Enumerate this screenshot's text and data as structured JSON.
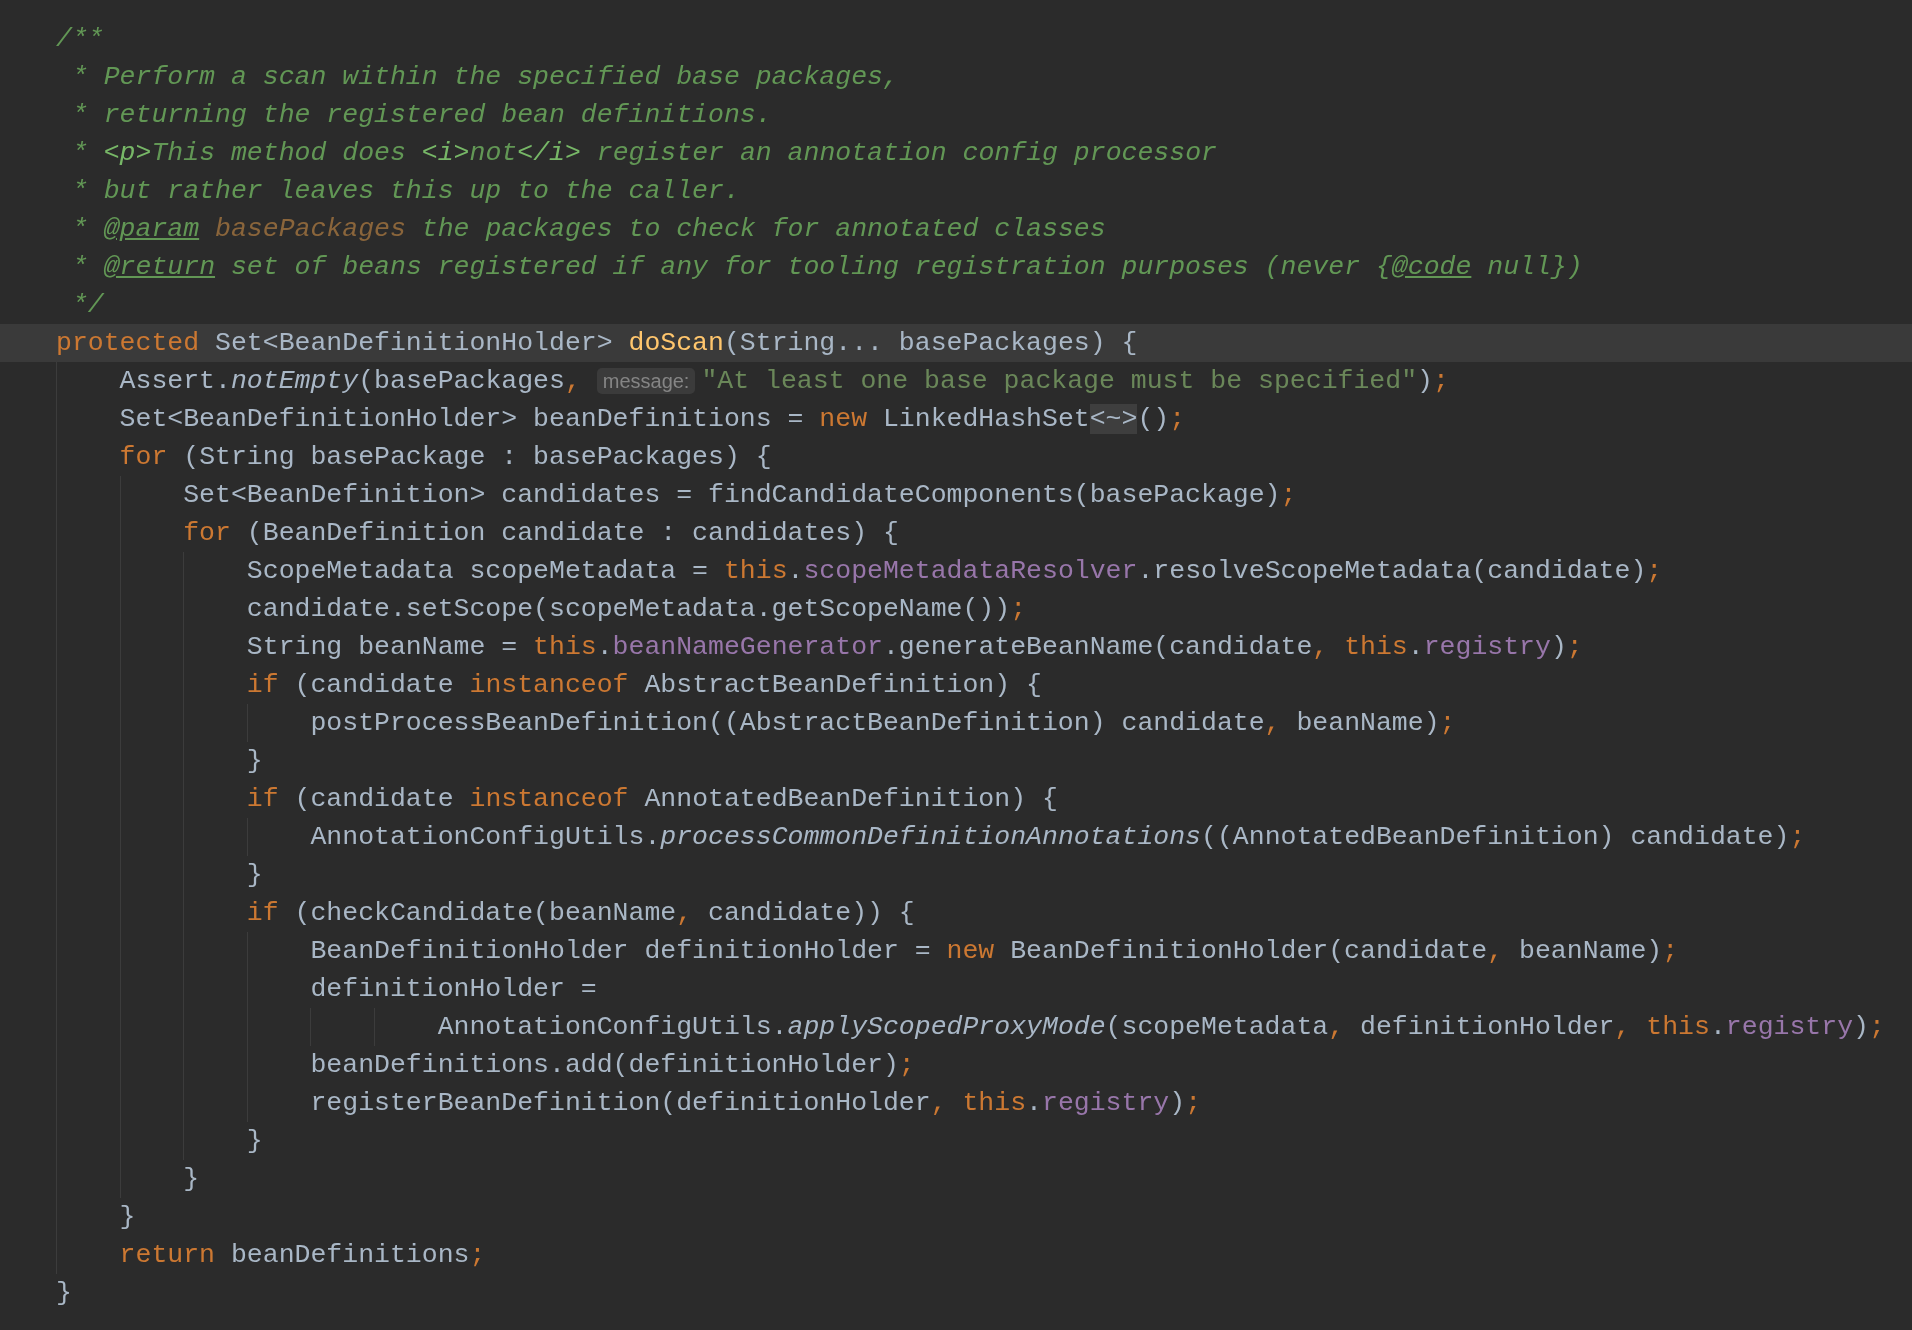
{
  "editor": {
    "lines": [
      {
        "current": false,
        "tokens": [
          {
            "kind": "doc",
            "text": "/**"
          }
        ]
      },
      {
        "current": false,
        "tokens": [
          {
            "kind": "doc",
            "text": " * Perform a scan within the specified base packages,"
          }
        ]
      },
      {
        "current": false,
        "tokens": [
          {
            "kind": "doc",
            "text": " * returning the registered bean definitions."
          }
        ]
      },
      {
        "current": false,
        "tokens": [
          {
            "kind": "doc",
            "text": " * "
          },
          {
            "kind": "dochtml",
            "text": "<p>"
          },
          {
            "kind": "doc",
            "text": "This method does "
          },
          {
            "kind": "dochtml",
            "text": "<i>"
          },
          {
            "kind": "doc",
            "text": "not"
          },
          {
            "kind": "dochtml",
            "text": "</i>"
          },
          {
            "kind": "doc",
            "text": " register an annotation config processor"
          }
        ]
      },
      {
        "current": false,
        "tokens": [
          {
            "kind": "doc",
            "text": " * but rather leaves this up to the caller."
          }
        ]
      },
      {
        "current": false,
        "tokens": [
          {
            "kind": "doc",
            "text": " * "
          },
          {
            "kind": "doctag",
            "text": "@param"
          },
          {
            "kind": "docparam",
            "text": " basePackages"
          },
          {
            "kind": "doc",
            "text": " the packages to check for annotated classes"
          }
        ]
      },
      {
        "current": false,
        "tokens": [
          {
            "kind": "doc",
            "text": " * "
          },
          {
            "kind": "doctag",
            "text": "@return"
          },
          {
            "kind": "doc",
            "text": " set of beans registered if any for tooling registration purposes (never {"
          },
          {
            "kind": "doctag",
            "text": "@code"
          },
          {
            "kind": "doc",
            "text": " null})"
          }
        ]
      },
      {
        "current": false,
        "tokens": [
          {
            "kind": "doc",
            "text": " */"
          }
        ]
      },
      {
        "current": true,
        "tokens": [
          {
            "kind": "kw",
            "text": "protected"
          },
          {
            "kind": "plain",
            "text": " Set<BeanDefinitionHolder> "
          },
          {
            "kind": "decl",
            "text": "doScan"
          },
          {
            "kind": "plain",
            "text": "(String... basePackages) {"
          }
        ]
      },
      {
        "current": false,
        "tokens": [
          {
            "kind": "plain",
            "text": "    Assert."
          },
          {
            "kind": "static",
            "text": "notEmpty"
          },
          {
            "kind": "plain",
            "text": "(basePackages"
          },
          {
            "kind": "kw",
            "text": ", "
          },
          {
            "kind": "hint",
            "text": "message:"
          },
          {
            "kind": "str",
            "text": "\"At least one base package must be specified\""
          },
          {
            "kind": "plain",
            "text": ")"
          },
          {
            "kind": "kw",
            "text": ";"
          }
        ]
      },
      {
        "current": false,
        "tokens": [
          {
            "kind": "plain",
            "text": "    Set<BeanDefinitionHolder> beanDefinitions = "
          },
          {
            "kind": "kw",
            "text": "new"
          },
          {
            "kind": "plain",
            "text": " LinkedHashSet"
          },
          {
            "kind": "fold",
            "text": "<~>"
          },
          {
            "kind": "plain",
            "text": "()"
          },
          {
            "kind": "kw",
            "text": ";"
          }
        ]
      },
      {
        "current": false,
        "tokens": [
          {
            "kind": "kw",
            "text": "    for"
          },
          {
            "kind": "plain",
            "text": " (String basePackage : basePackages) {"
          }
        ]
      },
      {
        "current": false,
        "tokens": [
          {
            "kind": "plain",
            "text": "        Set<BeanDefinition> candidates = findCandidateComponents(basePackage)"
          },
          {
            "kind": "kw",
            "text": ";"
          }
        ]
      },
      {
        "current": false,
        "tokens": [
          {
            "kind": "kw",
            "text": "        for"
          },
          {
            "kind": "plain",
            "text": " (BeanDefinition candidate : candidates) {"
          }
        ]
      },
      {
        "current": false,
        "tokens": [
          {
            "kind": "plain",
            "text": "            ScopeMetadata scopeMetadata = "
          },
          {
            "kind": "kw",
            "text": "this"
          },
          {
            "kind": "plain",
            "text": "."
          },
          {
            "kind": "field",
            "text": "scopeMetadataResolver"
          },
          {
            "kind": "plain",
            "text": ".resolveScopeMetadata(candidate)"
          },
          {
            "kind": "kw",
            "text": ";"
          }
        ]
      },
      {
        "current": false,
        "tokens": [
          {
            "kind": "plain",
            "text": "            candidate.setScope(scopeMetadata.getScopeName())"
          },
          {
            "kind": "kw",
            "text": ";"
          }
        ]
      },
      {
        "current": false,
        "tokens": [
          {
            "kind": "plain",
            "text": "            String beanName = "
          },
          {
            "kind": "kw",
            "text": "this"
          },
          {
            "kind": "plain",
            "text": "."
          },
          {
            "kind": "field",
            "text": "beanNameGenerator"
          },
          {
            "kind": "plain",
            "text": ".generateBeanName(candidate"
          },
          {
            "kind": "kw",
            "text": ", this"
          },
          {
            "kind": "plain",
            "text": "."
          },
          {
            "kind": "field",
            "text": "registry"
          },
          {
            "kind": "plain",
            "text": ")"
          },
          {
            "kind": "kw",
            "text": ";"
          }
        ]
      },
      {
        "current": false,
        "tokens": [
          {
            "kind": "kw",
            "text": "            if"
          },
          {
            "kind": "plain",
            "text": " (candidate "
          },
          {
            "kind": "kw",
            "text": "instanceof"
          },
          {
            "kind": "plain",
            "text": " AbstractBeanDefinition) {"
          }
        ]
      },
      {
        "current": false,
        "tokens": [
          {
            "kind": "plain",
            "text": "                postProcessBeanDefinition((AbstractBeanDefinition) candidate"
          },
          {
            "kind": "kw",
            "text": ","
          },
          {
            "kind": "plain",
            "text": " beanName)"
          },
          {
            "kind": "kw",
            "text": ";"
          }
        ]
      },
      {
        "current": false,
        "tokens": [
          {
            "kind": "plain",
            "text": "            }"
          }
        ]
      },
      {
        "current": false,
        "tokens": [
          {
            "kind": "kw",
            "text": "            if"
          },
          {
            "kind": "plain",
            "text": " (candidate "
          },
          {
            "kind": "kw",
            "text": "instanceof"
          },
          {
            "kind": "plain",
            "text": " AnnotatedBeanDefinition) {"
          }
        ]
      },
      {
        "current": false,
        "tokens": [
          {
            "kind": "plain",
            "text": "                AnnotationConfigUtils."
          },
          {
            "kind": "static",
            "text": "processCommonDefinitionAnnotations"
          },
          {
            "kind": "plain",
            "text": "((AnnotatedBeanDefinition) candidate)"
          },
          {
            "kind": "kw",
            "text": ";"
          }
        ]
      },
      {
        "current": false,
        "tokens": [
          {
            "kind": "plain",
            "text": "            }"
          }
        ]
      },
      {
        "current": false,
        "tokens": [
          {
            "kind": "kw",
            "text": "            if"
          },
          {
            "kind": "plain",
            "text": " (checkCandidate(beanName"
          },
          {
            "kind": "kw",
            "text": ","
          },
          {
            "kind": "plain",
            "text": " candidate)) {"
          }
        ]
      },
      {
        "current": false,
        "tokens": [
          {
            "kind": "plain",
            "text": "                BeanDefinitionHolder definitionHolder = "
          },
          {
            "kind": "kw",
            "text": "new"
          },
          {
            "kind": "plain",
            "text": " BeanDefinitionHolder(candidate"
          },
          {
            "kind": "kw",
            "text": ","
          },
          {
            "kind": "plain",
            "text": " beanName)"
          },
          {
            "kind": "kw",
            "text": ";"
          }
        ]
      },
      {
        "current": false,
        "tokens": [
          {
            "kind": "plain",
            "text": "                definitionHolder ="
          }
        ]
      },
      {
        "current": false,
        "tokens": [
          {
            "kind": "plain",
            "text": "                        AnnotationConfigUtils."
          },
          {
            "kind": "static",
            "text": "applyScopedProxyMode"
          },
          {
            "kind": "plain",
            "text": "(scopeMetadata"
          },
          {
            "kind": "kw",
            "text": ","
          },
          {
            "kind": "plain",
            "text": " definitionHolder"
          },
          {
            "kind": "kw",
            "text": ", this"
          },
          {
            "kind": "plain",
            "text": "."
          },
          {
            "kind": "field",
            "text": "registry"
          },
          {
            "kind": "plain",
            "text": ")"
          },
          {
            "kind": "kw",
            "text": ";"
          }
        ]
      },
      {
        "current": false,
        "tokens": [
          {
            "kind": "plain",
            "text": "                beanDefinitions.add(definitionHolder)"
          },
          {
            "kind": "kw",
            "text": ";"
          }
        ]
      },
      {
        "current": false,
        "tokens": [
          {
            "kind": "plain",
            "text": "                registerBeanDefinition(definitionHolder"
          },
          {
            "kind": "kw",
            "text": ", this"
          },
          {
            "kind": "plain",
            "text": "."
          },
          {
            "kind": "field",
            "text": "registry"
          },
          {
            "kind": "plain",
            "text": ")"
          },
          {
            "kind": "kw",
            "text": ";"
          }
        ]
      },
      {
        "current": false,
        "tokens": [
          {
            "kind": "plain",
            "text": "            }"
          }
        ]
      },
      {
        "current": false,
        "tokens": [
          {
            "kind": "plain",
            "text": "        }"
          }
        ]
      },
      {
        "current": false,
        "tokens": [
          {
            "kind": "plain",
            "text": "    }"
          }
        ]
      },
      {
        "current": false,
        "tokens": [
          {
            "kind": "kw",
            "text": "    return"
          },
          {
            "kind": "plain",
            "text": " beanDefinitions"
          },
          {
            "kind": "kw",
            "text": ";"
          }
        ]
      },
      {
        "current": false,
        "tokens": [
          {
            "kind": "plain",
            "text": "}"
          }
        ]
      }
    ]
  }
}
